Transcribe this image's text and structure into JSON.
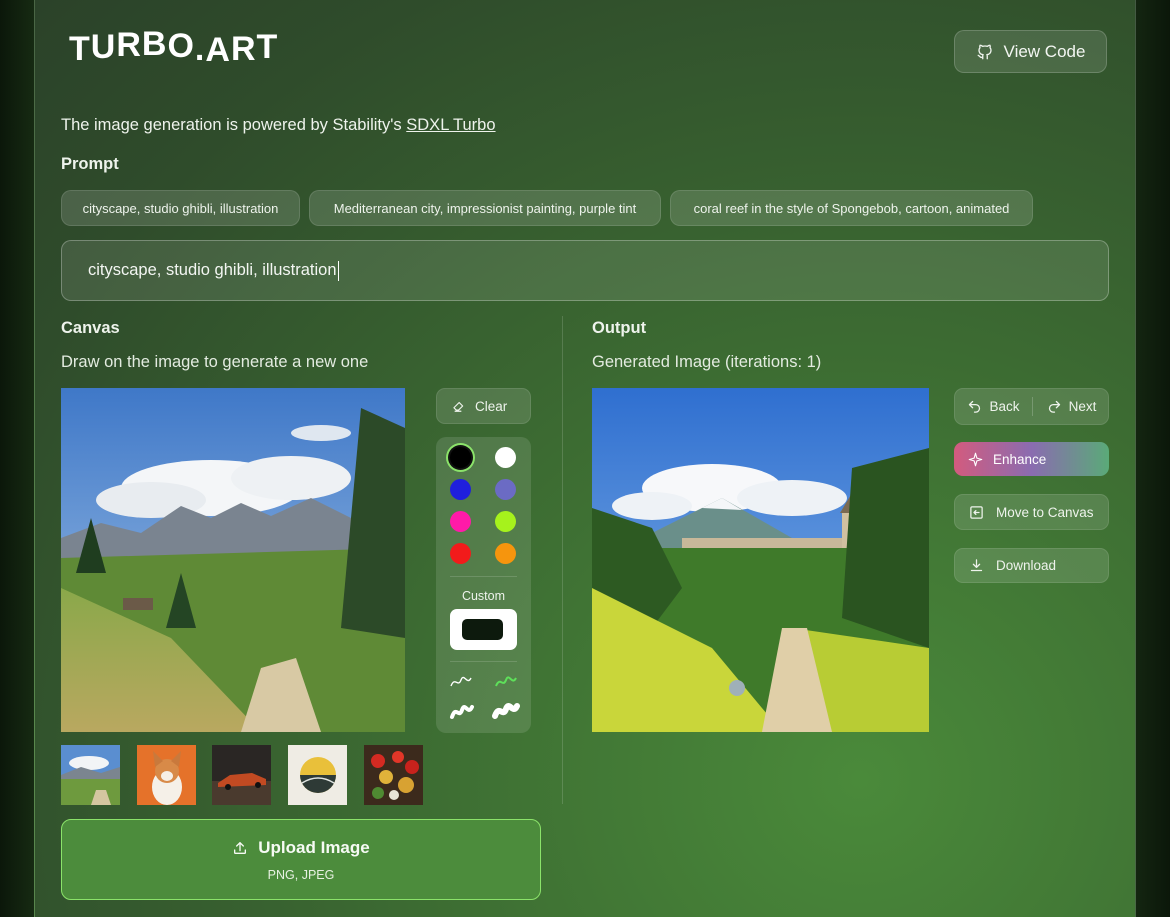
{
  "header": {
    "logo_text": "TURBO.ART",
    "view_code_label": "View Code"
  },
  "intro": {
    "powered_prefix": "The image generation is powered by Stability's ",
    "powered_link": "SDXL Turbo"
  },
  "prompt": {
    "label": "Prompt",
    "suggestions": [
      "cityscape, studio ghibli, illustration",
      "Mediterranean city, impressionist painting, purple tint",
      "coral reef in the style of Spongebob, cartoon, animated"
    ],
    "value": "cityscape, studio ghibli, illustration"
  },
  "canvas": {
    "title": "Canvas",
    "subtitle": "Draw on the image to generate a new one",
    "clear_label": "Clear",
    "colors": [
      "#000000",
      "#ffffff",
      "#1f1fdd",
      "#6b6bc4",
      "#ff1aa8",
      "#a6f21c",
      "#f21b1b",
      "#f6950d"
    ],
    "selected_color": "#000000",
    "custom_label": "Custom",
    "custom_color": "#0d1a0d",
    "brush_icons": [
      "thin-brush-icon",
      "thin-brush-selected-icon",
      "thick-brush-icon",
      "thicker-brush-icon"
    ],
    "upload_label": "Upload Image",
    "upload_hint": "PNG, JPEG"
  },
  "output": {
    "title": "Output",
    "subtitle": "Generated Image (iterations: 1)",
    "back_label": "Back",
    "next_label": "Next",
    "enhance_label": "Enhance",
    "move_label": "Move to Canvas",
    "download_label": "Download"
  },
  "colors": {
    "accent_green": "#8be36a",
    "upload_bg": "#4c8c3c"
  }
}
